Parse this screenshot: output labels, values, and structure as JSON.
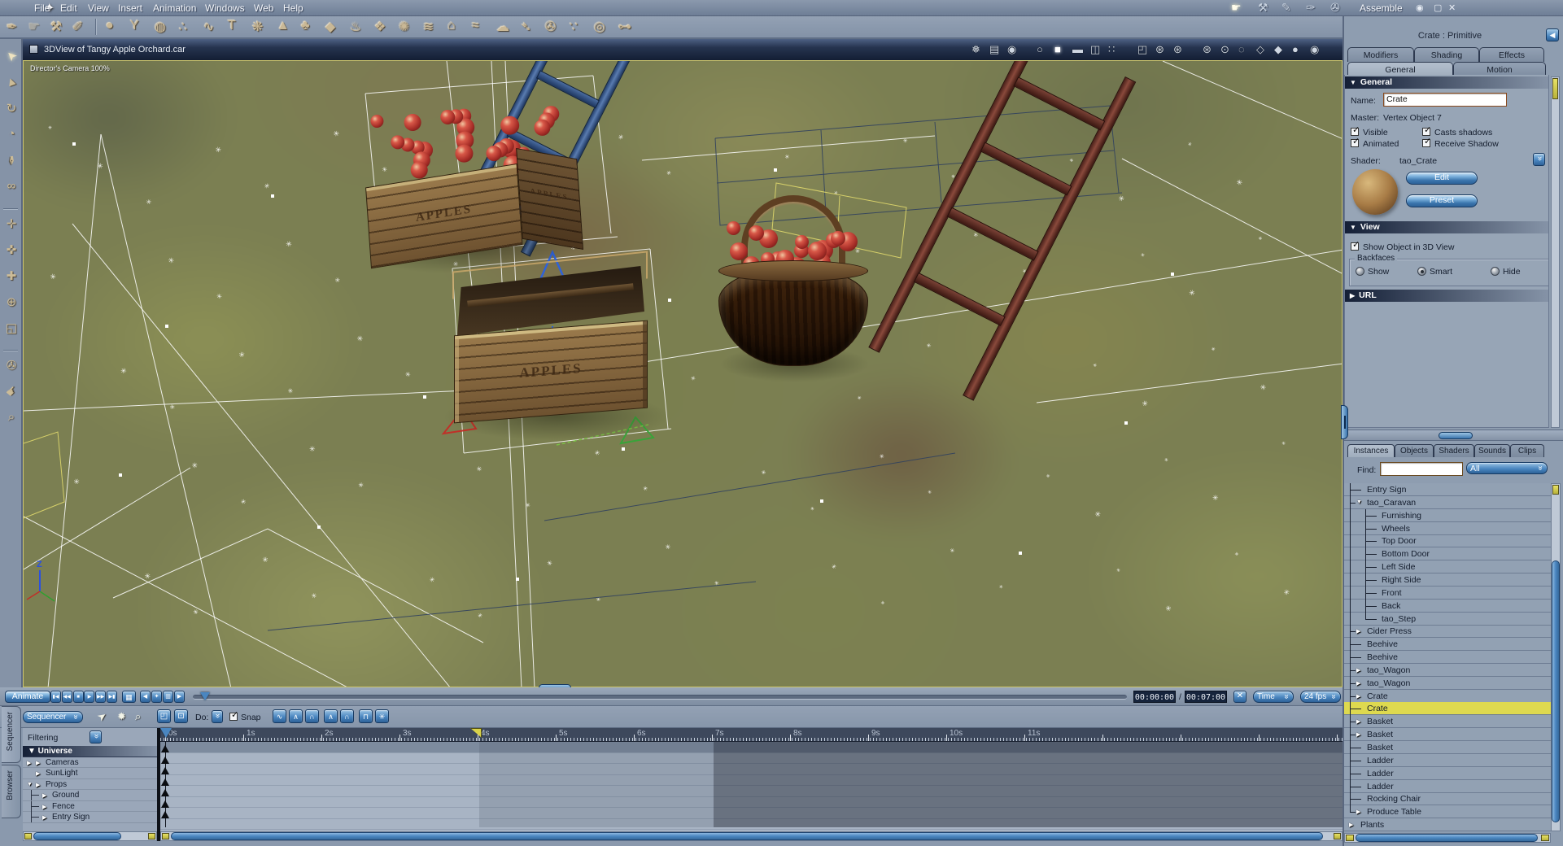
{
  "colors": {
    "accent": "#4a86c0",
    "selection_yellow": "#ded94f",
    "chrome": "#8e9db0",
    "titlebar": "#1c2a44"
  },
  "window": {
    "menus": [
      "File",
      "Edit",
      "View",
      "Insert",
      "Animation",
      "Windows",
      "Web",
      "Help"
    ],
    "mode_label": "Assemble",
    "mode_icons": [
      {
        "name": "pan-hand-icon",
        "glyph": "☛",
        "active": true
      },
      {
        "name": "assemble-wrench-icon",
        "glyph": "⚒"
      },
      {
        "name": "model-pen-icon",
        "glyph": "✎"
      },
      {
        "name": "texture-brush-icon",
        "glyph": "✑"
      },
      {
        "name": "render-film-icon",
        "glyph": "✇"
      }
    ],
    "window_controls": [
      {
        "name": "eye-icon",
        "glyph": "◉"
      },
      {
        "name": "maximize-icon",
        "glyph": "▢"
      },
      {
        "name": "close-icon",
        "glyph": "✕"
      }
    ]
  },
  "toolbar": {
    "left_tools": [
      {
        "name": "spline-tool-icon",
        "glyph": "✒"
      },
      {
        "name": "hand-tool-icon",
        "glyph": "☛"
      },
      {
        "name": "wrench-tool-icon",
        "glyph": "⚒"
      },
      {
        "name": "knife-tool-icon",
        "glyph": "✐"
      }
    ],
    "insert_tools": [
      {
        "name": "insert-sphere-icon",
        "glyph": "●"
      },
      {
        "name": "insert-vase-icon",
        "glyph": "Y"
      },
      {
        "name": "insert-globe-icon",
        "glyph": "◍"
      },
      {
        "name": "insert-metaball-icon",
        "glyph": "∴"
      },
      {
        "name": "insert-spring-icon",
        "glyph": "∿"
      },
      {
        "name": "insert-text-icon",
        "glyph": "T"
      },
      {
        "name": "insert-particles-icon",
        "glyph": "❋"
      },
      {
        "name": "insert-mountain-icon",
        "glyph": "▲"
      },
      {
        "name": "insert-tree-icon",
        "glyph": "♣"
      },
      {
        "name": "insert-rock-icon",
        "glyph": "◆"
      },
      {
        "name": "insert-fire-icon",
        "glyph": "♨"
      },
      {
        "name": "insert-crystal-icon",
        "glyph": "❖"
      },
      {
        "name": "insert-fan-icon",
        "glyph": "✺"
      },
      {
        "name": "insert-fountain-icon",
        "glyph": "≋"
      },
      {
        "name": "insert-house-icon",
        "glyph": "⌂"
      },
      {
        "name": "insert-ocean-icon",
        "glyph": "≈"
      },
      {
        "name": "insert-cloud-icon",
        "glyph": "☁"
      },
      {
        "name": "insert-spotlight-icon",
        "glyph": "➴"
      },
      {
        "name": "insert-camera-icon",
        "glyph": "✇"
      },
      {
        "name": "insert-emitter-icon",
        "glyph": "∵"
      },
      {
        "name": "insert-target-icon",
        "glyph": "◎"
      },
      {
        "name": "insert-bone-icon",
        "glyph": "⊶"
      }
    ]
  },
  "side_tools": [
    {
      "name": "select-arrow-tool-icon",
      "glyph": "➤",
      "rot": -135,
      "active": true
    },
    {
      "name": "move-3d-tool-icon",
      "glyph": "▲",
      "rot": -20
    },
    {
      "name": "rotate-tool-icon",
      "glyph": "↻",
      "rot": 0
    },
    {
      "name": "scale-tool-icon",
      "glyph": "◔",
      "rot": 0
    },
    {
      "name": "paint-tool-icon",
      "glyph": "✒",
      "rot": 90
    },
    {
      "name": "link-tool-icon",
      "glyph": "∞",
      "rot": 0
    },
    {
      "name": "sep"
    },
    {
      "name": "move-xy-tool-icon",
      "glyph": "✛",
      "rot": 0
    },
    {
      "name": "move-xz-tool-icon",
      "glyph": "✜",
      "rot": 0
    },
    {
      "name": "move-yz-tool-icon",
      "glyph": "✚",
      "rot": 0
    },
    {
      "name": "trackball-tool-icon",
      "glyph": "⊕",
      "rot": 0
    },
    {
      "name": "bank-tool-icon",
      "glyph": "◱",
      "rot": 0
    },
    {
      "name": "sep"
    },
    {
      "name": "camera-tool-icon",
      "glyph": "✇",
      "rot": 0
    },
    {
      "name": "pan-view-tool-icon",
      "glyph": "☛",
      "rot": -45
    },
    {
      "name": "zoom-tool-icon",
      "glyph": "⌕",
      "rot": 0
    }
  ],
  "viewport": {
    "title": "3DView of Tangy Apple Orchard.car",
    "camera_label": "Director's Camera 100%",
    "crate_label": "APPLES",
    "axis_label": "Z",
    "icons": [
      {
        "name": "motion-path-icon",
        "glyph": "❅"
      },
      {
        "name": "hierarchy-icon",
        "glyph": "▤"
      },
      {
        "name": "camera-dolly-icon",
        "glyph": "◉"
      },
      {
        "name": "production-frame-icon",
        "glyph": "○",
        "gap": true
      },
      {
        "name": "layout-single-pane-icon",
        "glyph": "■",
        "active": true
      },
      {
        "name": "layout-two-pane-icon",
        "glyph": "▬"
      },
      {
        "name": "layout-three-pane-icon",
        "glyph": "◫"
      },
      {
        "name": "layout-four-pane-icon",
        "glyph": "∷"
      },
      {
        "name": "layout-custom-pane-icon",
        "glyph": "◰",
        "gap": true
      },
      {
        "name": "draft-quality-low-icon",
        "glyph": "⊛"
      },
      {
        "name": "draft-quality-mid-icon",
        "glyph": "⊛"
      },
      {
        "name": "draft-quality-high-icon",
        "glyph": "⊛",
        "gap": true
      },
      {
        "name": "camera-reset-icon",
        "glyph": "⊙"
      },
      {
        "name": "wire-sphere-icon",
        "glyph": "◌"
      },
      {
        "name": "wireframe-cube-icon",
        "glyph": "◇"
      },
      {
        "name": "solid-cube-icon",
        "glyph": "◆"
      },
      {
        "name": "flat-shade-icon",
        "glyph": "●"
      },
      {
        "name": "textured-shade-icon",
        "glyph": "◉"
      }
    ]
  },
  "properties": {
    "header": "Crate : Primitive",
    "tabs_top": [
      "Modifiers",
      "Shading",
      "Effects"
    ],
    "tabs_sub": [
      "General",
      "Motion"
    ],
    "active_sub_tab": "General",
    "general": {
      "title": "General",
      "name_label": "Name:",
      "name_value": "Crate",
      "master_label": "Master:",
      "master_value": "Vertex Object 7",
      "cb_visible": "Visible",
      "cb_casts": "Casts shadows",
      "cb_animated": "Animated",
      "cb_receive": "Receive Shadow",
      "shader_label": "Shader:",
      "shader_value": "tao_Crate",
      "edit_button": "Edit",
      "preset_button": "Preset"
    },
    "view": {
      "title": "View",
      "show_object": "Show Object in 3D View",
      "backfaces_label": "Backfaces",
      "radios": [
        "Show",
        "Smart",
        "Hide"
      ],
      "selected_radio": "Smart"
    },
    "url": {
      "title": "URL"
    }
  },
  "browser": {
    "tabs": [
      "Instances",
      "Objects",
      "Shaders",
      "Sounds",
      "Clips"
    ],
    "active_tab": "Instances",
    "find_label": "Find:",
    "find_value": "",
    "filter_value": "All",
    "items": [
      {
        "label": "Entry Sign"
      },
      {
        "label": "tao_Caravan",
        "arrow": "open"
      },
      {
        "label": "Furnishing",
        "child": true
      },
      {
        "label": "Wheels",
        "child": true
      },
      {
        "label": "Top Door",
        "child": true
      },
      {
        "label": "Bottom Door",
        "child": true
      },
      {
        "label": "Left Side",
        "child": true
      },
      {
        "label": "Right Side",
        "child": true
      },
      {
        "label": "Front",
        "child": true
      },
      {
        "label": "Back",
        "child": true
      },
      {
        "label": "tao_Step",
        "child": true,
        "childLast": true
      },
      {
        "label": "Cider Press",
        "arrow": "closed"
      },
      {
        "label": "Beehive"
      },
      {
        "label": "Beehive"
      },
      {
        "label": "tao_Wagon",
        "arrow": "closed"
      },
      {
        "label": "tao_Wagon",
        "arrow": "closed"
      },
      {
        "label": "Crate",
        "arrow": "closed"
      },
      {
        "label": "Crate",
        "selected": true
      },
      {
        "label": "Basket",
        "arrow": "closed"
      },
      {
        "label": "Basket",
        "arrow": "closed"
      },
      {
        "label": "Basket"
      },
      {
        "label": "Ladder"
      },
      {
        "label": "Ladder"
      },
      {
        "label": "Ladder"
      },
      {
        "label": "Rocking Chair"
      },
      {
        "label": "Produce Table",
        "arrow": "closed",
        "last": true
      },
      {
        "label": "Plants",
        "arrow": "closed",
        "root": true
      }
    ]
  },
  "transport": {
    "animate_button": "Animate",
    "playback": [
      {
        "name": "go-start-button",
        "glyph": "▮◀"
      },
      {
        "name": "prev-frame-button",
        "glyph": "◀◀"
      },
      {
        "name": "stop-button",
        "glyph": "■"
      },
      {
        "name": "play-button",
        "glyph": "▶"
      },
      {
        "name": "next-frame-button",
        "glyph": "▶▶"
      },
      {
        "name": "go-end-button",
        "glyph": "▶▮"
      }
    ],
    "render_preview_glyph": "▦",
    "key_buttons": [
      {
        "name": "prev-key-button",
        "glyph": "◀"
      },
      {
        "name": "add-key-button",
        "glyph": "✦"
      },
      {
        "name": "delete-key-button",
        "glyph": "▥"
      },
      {
        "name": "next-key-button",
        "glyph": "▶"
      }
    ],
    "current_time": "00:00:00",
    "total_time": "00:07:00",
    "loop_glyph": "✕",
    "time_mode": "Time",
    "fps": "24 fps"
  },
  "sequencer": {
    "side_tabs": [
      "Sequencer",
      "Browser"
    ],
    "dropdown": "Sequencer",
    "do_label": "Do:",
    "snap_label": "Snap",
    "filtering_label": "Filtering",
    "tool_icons": [
      {
        "name": "cursor-icon",
        "glyph": "➤"
      },
      {
        "name": "light-icon",
        "glyph": "✹"
      },
      {
        "name": "zoom-icon",
        "glyph": "⌕"
      }
    ],
    "fit_icons": [
      {
        "name": "fit-selection-button",
        "glyph": "◰"
      },
      {
        "name": "fit-time-button",
        "glyph": "⊡"
      }
    ],
    "tweeners": [
      {
        "name": "tweener-bezier-button",
        "glyph": "∿"
      },
      {
        "name": "tweener-linear-button",
        "glyph": "∧"
      },
      {
        "name": "tweener-smooth-button",
        "glyph": "∩"
      },
      {
        "name": "tweener-oscillate-button",
        "glyph": "∧"
      },
      {
        "name": "tweener-oscillate2-button",
        "glyph": "∩"
      },
      {
        "name": "tweener-clamp-button",
        "glyph": "⊓"
      },
      {
        "name": "tweener-noise-button",
        "glyph": "✳"
      }
    ],
    "tree": [
      {
        "label": "Universe",
        "type": "header"
      },
      {
        "label": "Cameras",
        "a1": "closed",
        "a2": "closed"
      },
      {
        "label": "SunLight",
        "a2": "closed"
      },
      {
        "label": "Props",
        "a1": "open",
        "a2": "closed"
      },
      {
        "label": "Ground",
        "child": true
      },
      {
        "label": "Fence",
        "child": true
      },
      {
        "label": "Entry Sign",
        "child": true
      }
    ],
    "ruler_seconds": [
      "0s",
      "1s",
      "2s",
      "3s",
      "4s",
      "5s",
      "6s",
      "7s",
      "8s",
      "9s",
      "10s",
      "11s"
    ]
  }
}
